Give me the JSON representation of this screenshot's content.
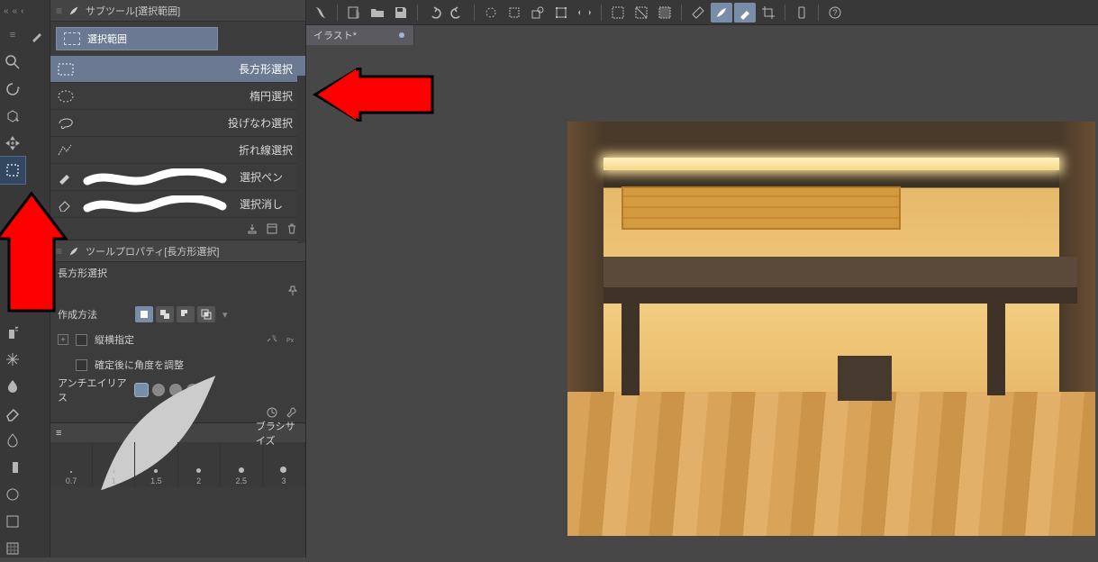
{
  "toolbar": {
    "icons": [
      "logo",
      "new",
      "open",
      "save",
      "undo",
      "redo",
      "spin",
      "rect-sel",
      "shape",
      "transform",
      "flip",
      "sep",
      "sel-a",
      "sel-b",
      "sel-c",
      "ruler",
      "pen-a",
      "pen-b",
      "crop",
      "tablet",
      "help"
    ]
  },
  "tab": {
    "label": "イラスト*"
  },
  "left_tools": {
    "items": [
      "menu",
      "brush",
      "magnify",
      "loop",
      "cube-arrow",
      "move",
      "marquee",
      "",
      "",
      "",
      "",
      "",
      "",
      "",
      "",
      "",
      ""
    ],
    "selected_index": 5
  },
  "brush_tools": [
    "spray",
    "asterisk",
    "drop",
    "eraser",
    "flame",
    "gradient",
    "circle",
    "rect",
    "grid"
  ],
  "subtool_panel": {
    "title": "サブツール[選択範囲]",
    "category_label": "選択範囲",
    "items": [
      {
        "label": "長方形選択"
      },
      {
        "label": "楕円選択"
      },
      {
        "label": "投げなわ選択"
      },
      {
        "label": "折れ線選択"
      },
      {
        "label": "選択ペン"
      },
      {
        "label": "選択消し"
      }
    ],
    "selected_index": 0
  },
  "tool_property": {
    "title": "ツールプロパティ[長方形選択]",
    "tool_name": "長方形選択",
    "rows": {
      "creation_method": "作成方法",
      "aspect_lock": "縦横指定",
      "adjust_angle": "確定後に角度を調整",
      "antialias": "アンチエイリアス"
    }
  },
  "brush_size_panel": {
    "title": "ブラシサイズ",
    "presets": [
      "0.7",
      "1",
      "1.5",
      "2",
      "2.5",
      "3"
    ]
  }
}
